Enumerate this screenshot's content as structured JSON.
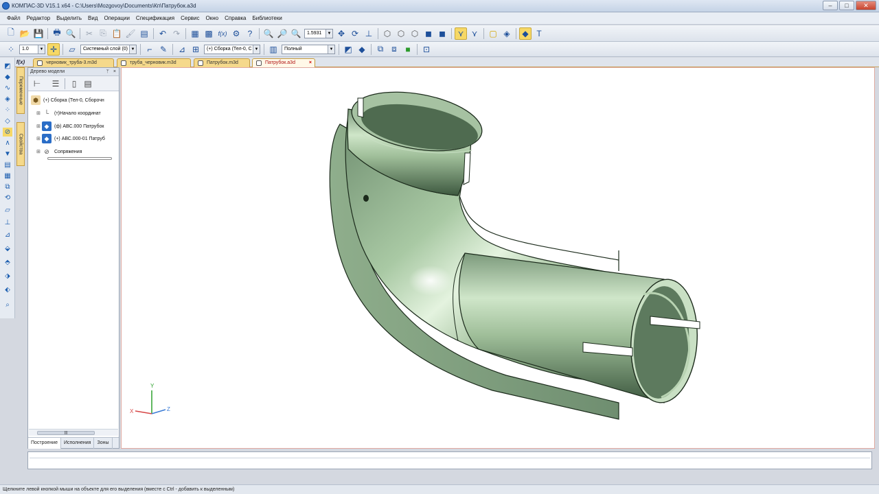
{
  "window": {
    "title": "КОМПАС-3D V15.1 x64 - C:\\Users\\Mozgovoy\\Documents\\Кп\\Патрубок.a3d"
  },
  "menu": [
    "Файл",
    "Редактор",
    "Выделить",
    "Вид",
    "Операции",
    "Спецификация",
    "Сервис",
    "Окно",
    "Справка",
    "Библиотеки"
  ],
  "toolbar": {
    "zoom_value": "1.5931",
    "step_value": "1.0",
    "layer_value": "Системный слой (0)",
    "context_value": "(+) Сборка (Тел-0, С",
    "display_mode_value": "Полный"
  },
  "tabs": {
    "fx_label": "f(x)",
    "documents": [
      {
        "label": "черновик_труба-3.m3d",
        "active": false
      },
      {
        "label": "труба_черновик.m3d",
        "active": false
      },
      {
        "label": "Патрубок.m3d",
        "active": false
      },
      {
        "label": "Патрубок.a3d",
        "active": true
      }
    ]
  },
  "side_tabs": [
    "Переменные",
    "Свойства"
  ],
  "model_tree": {
    "header": "Дерево модели",
    "items": [
      {
        "label": "(+) Сборка (Тел-0, Сборочн",
        "icon": "assembly-icon"
      },
      {
        "label": "(т)Начало координат",
        "icon": "origin-icon"
      },
      {
        "label": "(ф) АВС.000 Патрубок",
        "icon": "part-icon"
      },
      {
        "label": "(+) АВС.000-01 Патруб",
        "icon": "part-icon"
      },
      {
        "label": "Сопряжения",
        "icon": "mates-icon"
      }
    ],
    "bottom_tabs": [
      "Построение",
      "Исполнения",
      "Зоны"
    ]
  },
  "axes": {
    "x": "X",
    "y": "Y",
    "z": "Z"
  },
  "status": {
    "hint": "Щелкните левой кнопкой мыши на объекте для его выделения (вместе с Ctrl - добавить к выделенным)"
  },
  "colors": {
    "model": "#b5d3ae",
    "model_dark": "#4d6a4f",
    "highlight_tab": "#f5d98b"
  }
}
